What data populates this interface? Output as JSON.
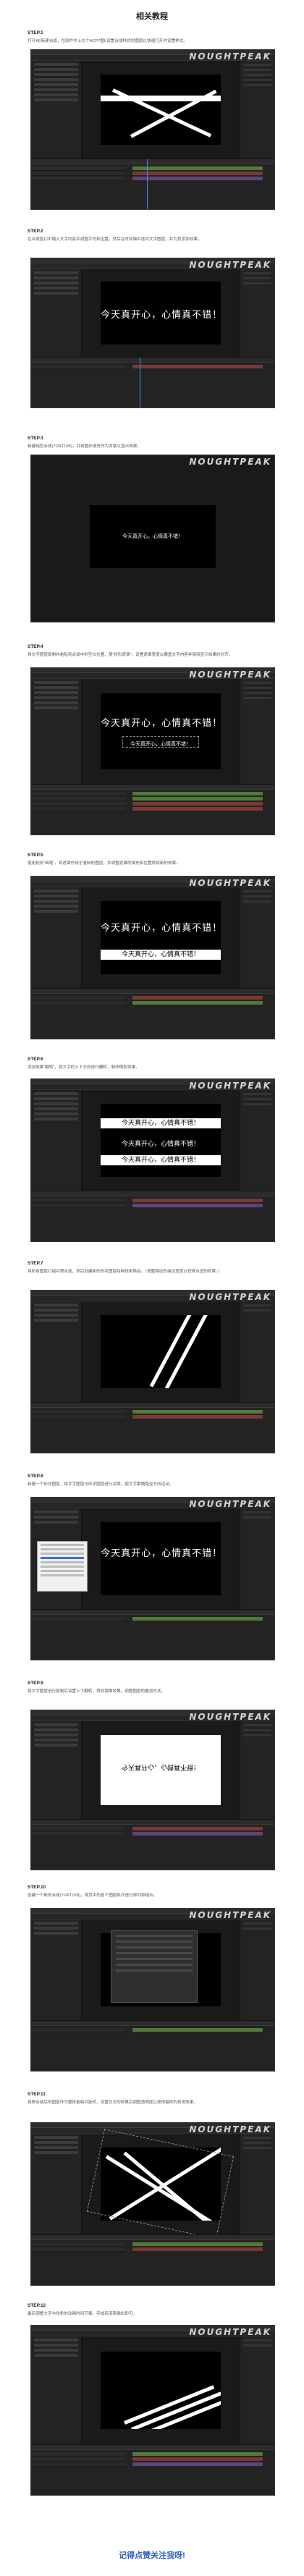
{
  "page": {
    "title": "相关教程",
    "footer": "记得点赞关注我呀!"
  },
  "steps": [
    {
      "label": "STEP.1",
      "desc": "打开AE新建合成，在软件中上方个ACP7图L设置合成样式的图层以快速打开并设置样式。"
    },
    {
      "label": "STEP.2",
      "desc": "在合成窗口中输入文字内容并调整字号和位置，然后在时间轴中选中文字图层，并为其添加效果。"
    },
    {
      "label": "STEP.3",
      "desc": "新建纯色合成(7GBT16B)，并将图形填充作为背景以显示效果。"
    },
    {
      "label": "STEP.4",
      "desc": "将文字图层复制并粘贴到合成中的空白位置，使“矩形遮罩”，设置遮罩宽度以覆盖文字内容并保持显示效果的对齐。"
    },
    {
      "label": "STEP.5",
      "desc": "使用矩形“画笔”，将遮罩作用于复制的图层，并调整遮罩的填充和位置得到新的效果。"
    },
    {
      "label": "STEP.6",
      "desc": "添加效果“翻转”，将文字的上下方向进行翻转，制作倒影效果。"
    },
    {
      "label": "STEP.7",
      "desc": "将所有图层打组并预合成，然后创建新的形状图层绘制线条路径。（调整路径的描边宽度以获得合适的效果。）"
    },
    {
      "label": "STEP.8",
      "desc": "新建一个形状图层，将文字图层与形状图层进行关联，使文字跟随路径方向运动。"
    },
    {
      "label": "STEP.9",
      "desc": "将文字图层进行复制后设置上下翻转，得到镜像效果，调整图层的叠加方式。"
    },
    {
      "label": "STEP.10",
      "desc": "创建一个新的合成(7GBT16B)，将其中的各个图层依次进行排列和组合。"
    },
    {
      "label": "STEP.11",
      "desc": "将预合成后的图层作为整体复制并旋转，设置交叉的效果后调整透明度以获得最终的视觉效果。"
    },
    {
      "label": "STEP.12",
      "desc": "最后调整文字与线条的动画时间节奏，完成后渲染输出即可。"
    }
  ],
  "canvas_texts": {
    "main_line": "今天真开心，心情真不错！",
    "small_line": "今天真开心，心情真不错！",
    "mirror_line": "今天真开心，心情真不错！"
  },
  "watermark": "NOUGHTPEAK",
  "colors": {
    "accent_blue": "#2b5fb8",
    "ui_bg": "#1e1e1e",
    "layer_green": "#5a8a3c",
    "layer_red": "#8a3c3c",
    "layer_purple": "#6a4a8a",
    "playhead": "#3c8cff"
  }
}
